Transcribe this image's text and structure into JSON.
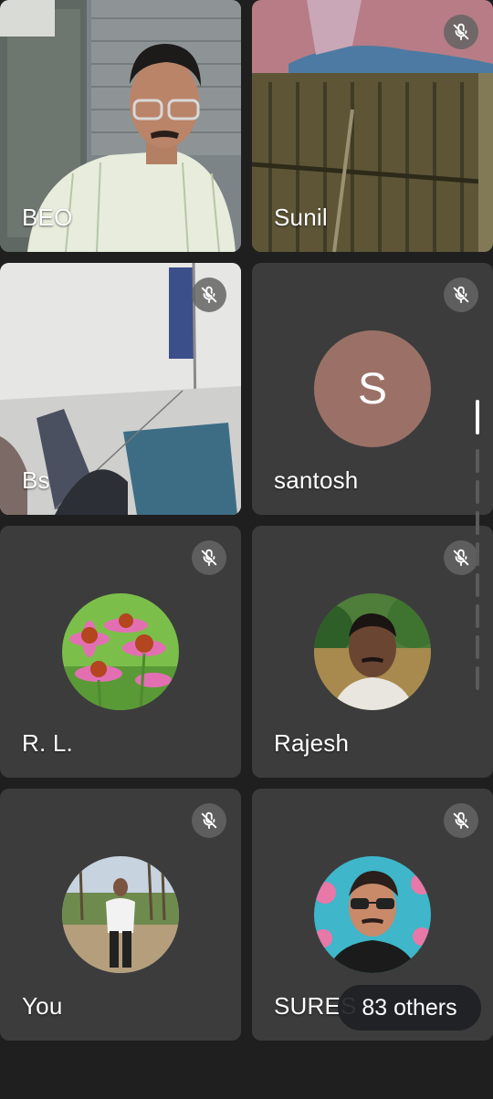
{
  "participants": [
    {
      "name": "BEO",
      "muted": false,
      "kind": "video",
      "speaking": true
    },
    {
      "name": "Sunil",
      "muted": true,
      "kind": "video"
    },
    {
      "name": "Bs",
      "muted": true,
      "kind": "video"
    },
    {
      "name": "santosh",
      "muted": true,
      "kind": "letter-avatar",
      "initial": "S",
      "avatar_color": "#9b7167"
    },
    {
      "name": "R. L.",
      "muted": true,
      "kind": "photo-avatar"
    },
    {
      "name": "Rajesh",
      "muted": true,
      "kind": "photo-avatar"
    },
    {
      "name": "You",
      "muted": true,
      "kind": "photo-avatar"
    },
    {
      "name": "SURES",
      "muted": true,
      "kind": "photo-avatar"
    }
  ],
  "overflow": {
    "label": "83 others"
  },
  "icons": {
    "mute": "mic-off-icon"
  },
  "colors": {
    "background": "#1f1f1f",
    "tile": "#3c3c3c",
    "active_border": "#8a2432"
  }
}
